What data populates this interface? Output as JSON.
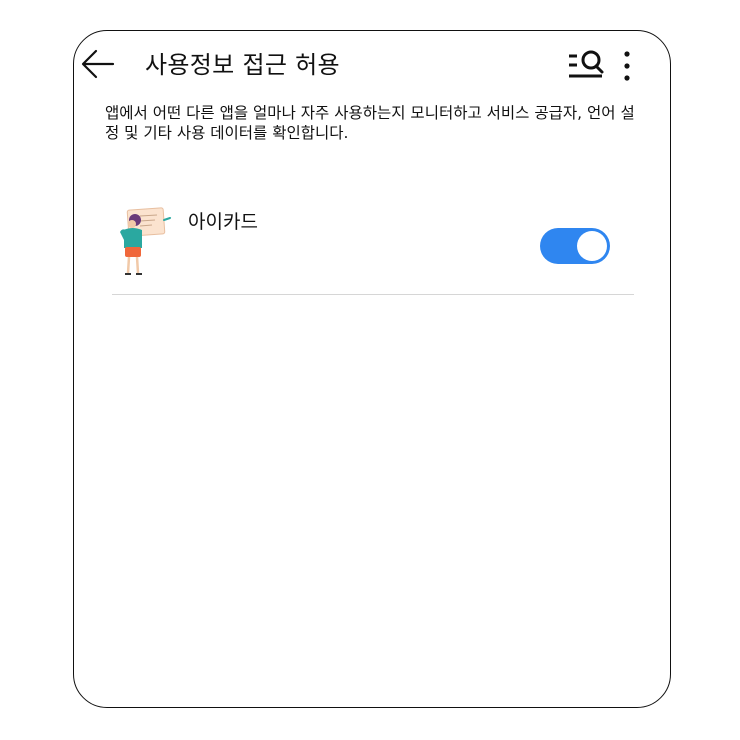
{
  "header": {
    "title": "사용정보 접근 허용",
    "back_icon": "arrow-left-icon",
    "search_icon": "search-list-icon",
    "more_icon": "more-vertical-icon"
  },
  "description": "앱에서 어떤 다른 앱을 얼마나 자주 사용하는지 모니터하고 서비스 공급자, 언어 설정 및 기타 사용 데이터를 확인합니다.",
  "apps": [
    {
      "name": "아이카드",
      "icon": "app-illustration-icon",
      "enabled": true
    }
  ],
  "colors": {
    "toggle_on": "#2f86f0",
    "divider": "#d6d6d6"
  }
}
